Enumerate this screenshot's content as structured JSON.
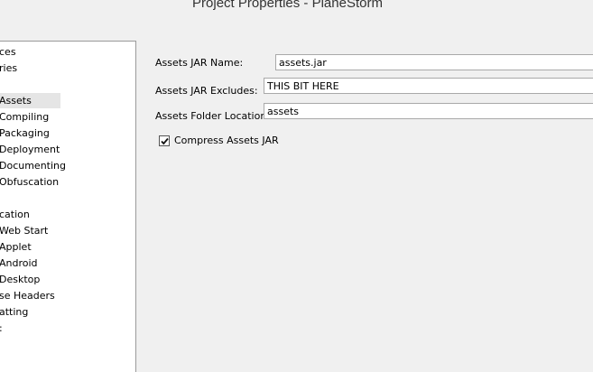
{
  "window": {
    "title": "Project Properties - PlaneStorm"
  },
  "categories": {
    "items": [
      {
        "label": "ces",
        "selected": false
      },
      {
        "label": "ries",
        "selected": false
      },
      {
        "label": "",
        "selected": false
      },
      {
        "label": "Assets",
        "selected": true
      },
      {
        "label": "Compiling",
        "selected": false
      },
      {
        "label": "Packaging",
        "selected": false
      },
      {
        "label": "Deployment",
        "selected": false
      },
      {
        "label": "Documenting",
        "selected": false
      },
      {
        "label": "Obfuscation",
        "selected": false
      },
      {
        "label": "",
        "selected": false
      },
      {
        "label": "cation",
        "selected": false
      },
      {
        "label": "Web Start",
        "selected": false
      },
      {
        "label": "Applet",
        "selected": false
      },
      {
        "label": "Android",
        "selected": false
      },
      {
        "label": "Desktop",
        "selected": false
      },
      {
        "label": "se Headers",
        "selected": false
      },
      {
        "label": "atting",
        "selected": false
      },
      {
        "label": ":",
        "selected": false
      }
    ]
  },
  "assets_panel": {
    "jar_name_label": "Assets JAR Name:",
    "jar_name_value": "assets.jar",
    "jar_excludes_label": "Assets JAR Excludes:",
    "jar_excludes_value": "THIS BIT HERE",
    "folder_location_label": "Assets Folder Location:",
    "folder_location_value": "assets",
    "compress_label": "Compress Assets JAR",
    "compress_checked": true
  }
}
